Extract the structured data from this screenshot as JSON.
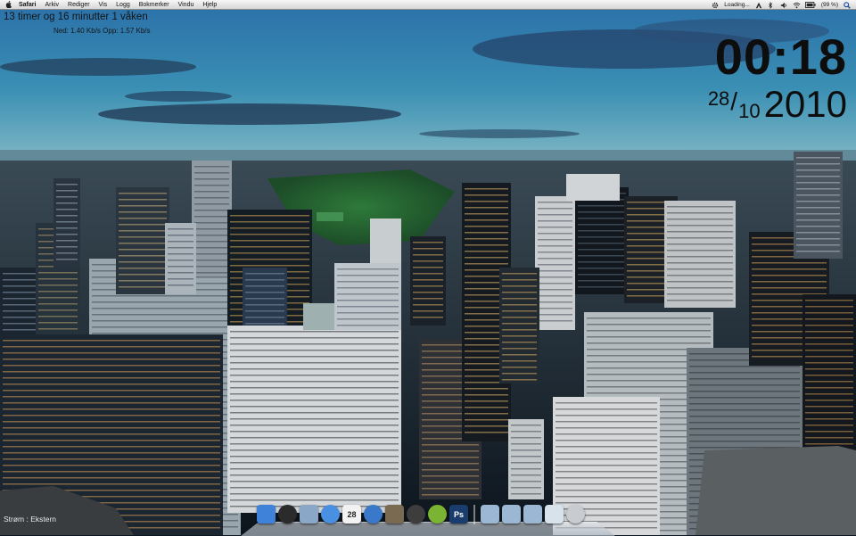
{
  "menubar": {
    "app": "Safari",
    "items": [
      "Arkiv",
      "Rediger",
      "Vis",
      "Logg",
      "Bokmerker",
      "Vindu",
      "Hjelp"
    ],
    "status_loading": "Loading...",
    "battery": "(99 %)",
    "status_icons": [
      "gear-icon",
      "adobe-icon",
      "bluetooth-icon",
      "volume-icon",
      "wifi-icon",
      "battery-icon",
      "search-icon"
    ]
  },
  "desktop": {
    "awake_time": "13 timer og 16 minutter 1 våken",
    "net_speed": "Ned: 1.40 Kb/s Opp: 1.57 Kb/s",
    "clock": "00:18",
    "date": {
      "day": "28",
      "month": "10",
      "year": "2010"
    },
    "power_source": "Strøm : Ekstern"
  },
  "dock": {
    "apps": [
      {
        "name": "finder-icon",
        "color": "#3f82d9"
      },
      {
        "name": "dashboard-icon",
        "color": "#2b2b2b"
      },
      {
        "name": "mail-icon",
        "color": "#8aa7c7"
      },
      {
        "name": "safari-icon",
        "color": "#4a90e2"
      },
      {
        "name": "ical-icon",
        "color": "#f2f2f2",
        "label": "28"
      },
      {
        "name": "itunes-icon",
        "color": "#3a78c9"
      },
      {
        "name": "iphoto-icon",
        "color": "#7a6a52"
      },
      {
        "name": "camera-icon",
        "color": "#3d3d3d"
      },
      {
        "name": "spotify-icon",
        "color": "#7bb332"
      },
      {
        "name": "photoshop-icon",
        "color": "#1b3d6e",
        "label": "Ps"
      }
    ],
    "stacks": [
      {
        "name": "folder-icon",
        "color": "#9cb7d4"
      },
      {
        "name": "folder-icon",
        "color": "#9cb7d4"
      },
      {
        "name": "folder-icon",
        "color": "#9cb7d4"
      },
      {
        "name": "document-stack-icon",
        "color": "#d8e2ea"
      },
      {
        "name": "trash-icon",
        "color": "#c8ccd0"
      }
    ]
  }
}
